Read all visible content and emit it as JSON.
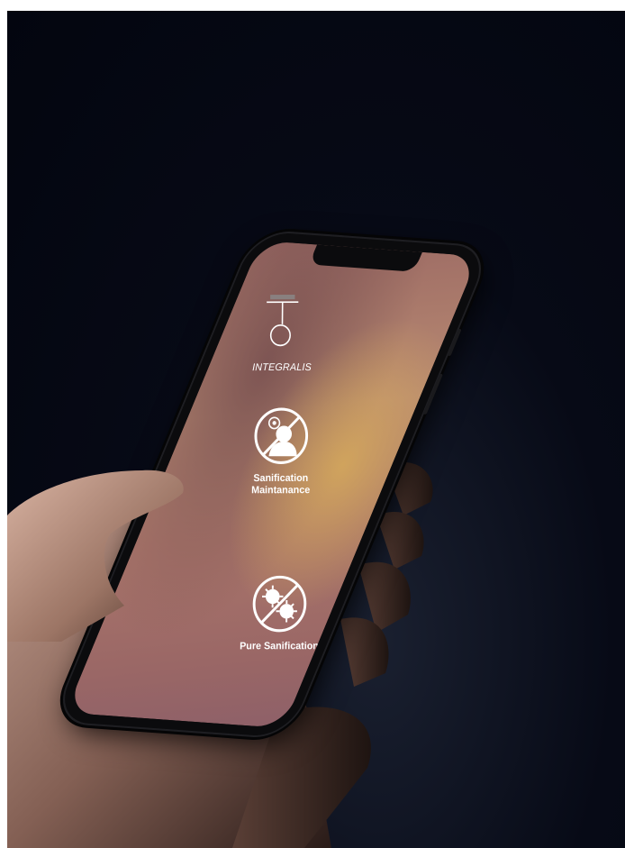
{
  "app": {
    "device_name": "INTEGRALIS"
  },
  "navigation": {
    "back_icon": "arrow-left-icon",
    "settings_icon": "gear-icon"
  },
  "modes": [
    {
      "label_line1": "Sanification",
      "label_line2": "Maintanance",
      "icon": "no-person-virus-icon"
    },
    {
      "label_line1": "Pure Sanification",
      "label_line2": "",
      "icon": "no-virus-icon"
    }
  ],
  "colors": {
    "background": "#050812",
    "screen_gradient_warm": "#d6aa5a",
    "screen_gradient_base": "#a9756a",
    "text": "#ffffff"
  }
}
